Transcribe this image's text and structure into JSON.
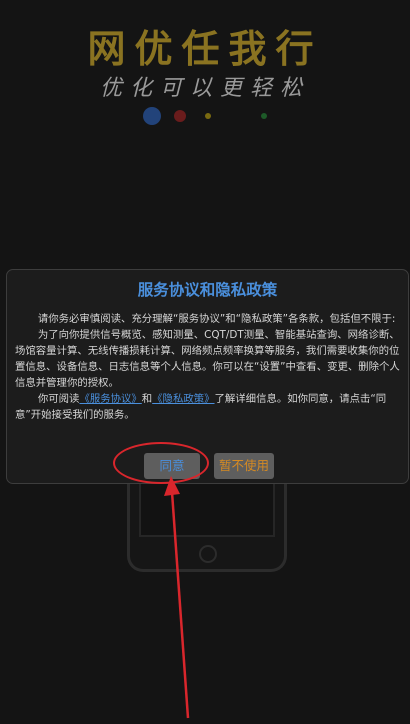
{
  "app": {
    "title": "网优任我行",
    "slogan": "优化可以更轻松"
  },
  "dialog": {
    "title": "服务协议和隐私政策",
    "para1": "请你务必审慎阅读、充分理解“服务协议”和“隐私政策”各条款，包括但不限于:",
    "para2": "为了向你提供信号概览、感知测量、CQT/DT测量、智能基站查询、网络诊断、场馆容量计算、无线传播损耗计算、网络频点频率换算等服务，我们需要收集你的位置信息、设备信息、日志信息等个人信息。你可以在“设置”中查看、变更、删除个人信息并管理你的授权。",
    "para3_prefix": "你可阅读",
    "service_link": "《服务协议》",
    "para3_and": "和",
    "privacy_link": "《隐私政策》",
    "para3_suffix": "了解详细信息。如你同意，请点击“同意”开始接受我们的服务。",
    "agree_label": "同意",
    "decline_label": "暂不使用"
  },
  "colors": {
    "title_gold": "#8a7321",
    "link_blue": "#4a8fdc",
    "decline_orange": "#d58a23",
    "annotation_red": "#d9262c"
  }
}
